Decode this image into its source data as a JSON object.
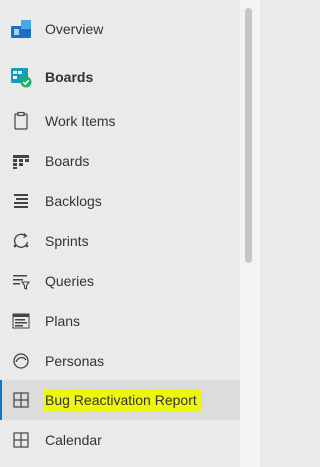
{
  "nav": {
    "items": [
      {
        "label": "Overview",
        "icon": "overview-icon"
      },
      {
        "label": "Boards",
        "icon": "boards-hub-icon"
      },
      {
        "label": "Work Items",
        "icon": "work-items-icon"
      },
      {
        "label": "Boards",
        "icon": "boards-icon"
      },
      {
        "label": "Backlogs",
        "icon": "backlogs-icon"
      },
      {
        "label": "Sprints",
        "icon": "sprints-icon"
      },
      {
        "label": "Queries",
        "icon": "queries-icon"
      },
      {
        "label": "Plans",
        "icon": "plans-icon"
      },
      {
        "label": "Personas",
        "icon": "personas-icon"
      },
      {
        "label": "Bug Reactivation Report",
        "icon": "report-grid-icon",
        "selected": true,
        "highlighted": true
      },
      {
        "label": "Calendar",
        "icon": "calendar-grid-icon"
      }
    ]
  },
  "colors": {
    "accent": "#0078d4",
    "boards_brand": "#009ccc",
    "check_badge": "#17b26a",
    "highlight": "#eef70a"
  }
}
